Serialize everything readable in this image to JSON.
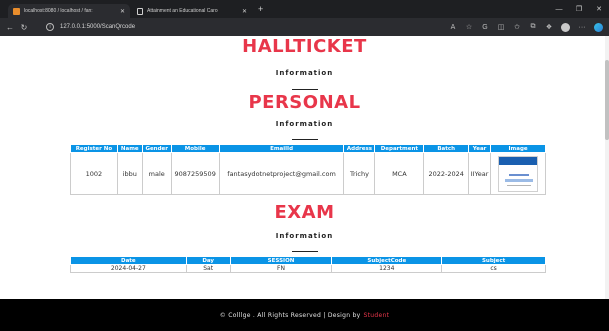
{
  "browser": {
    "tabs": [
      {
        "label": "localhost:8080 / localhost / fan:"
      },
      {
        "label": "Attainment an Educational Caro"
      }
    ],
    "url": "127.0.0.1:5000/ScanQrcode"
  },
  "page": {
    "hallticket_title": "HALLTICKET",
    "hallticket_sub": "Information",
    "personal_title": "PERSONAL",
    "personal_sub": "Information",
    "exam_title": "EXAM",
    "exam_sub": "Information"
  },
  "personal_table": {
    "headers": [
      "Register No",
      "Name",
      "Gender",
      "Mobile",
      "EmailId",
      "Address",
      "Department",
      "Batch",
      "Year",
      "Image"
    ],
    "row": {
      "register_no": "1002",
      "name": "ibbu",
      "gender": "male",
      "mobile": "9087259509",
      "email": "fantasydotnetproject@gmail.com",
      "address": "Trichy",
      "department": "MCA",
      "batch": "2022-2024",
      "year": "IIYear"
    }
  },
  "exam_table": {
    "headers": [
      "Date",
      "Day",
      "SESSION",
      "SubjectCode",
      "Subject"
    ],
    "row": {
      "date": "2024-04-27",
      "day": "Sat",
      "session": "FN",
      "subject_code": "1234",
      "subject": "cs"
    }
  },
  "footer": {
    "text": "© Colllge . All Rights Reserved | Design by",
    "credit": "Student"
  },
  "colors": {
    "accent_red": "#e8364a",
    "header_blue": "#0a94e6",
    "footer_bg": "#000000"
  }
}
